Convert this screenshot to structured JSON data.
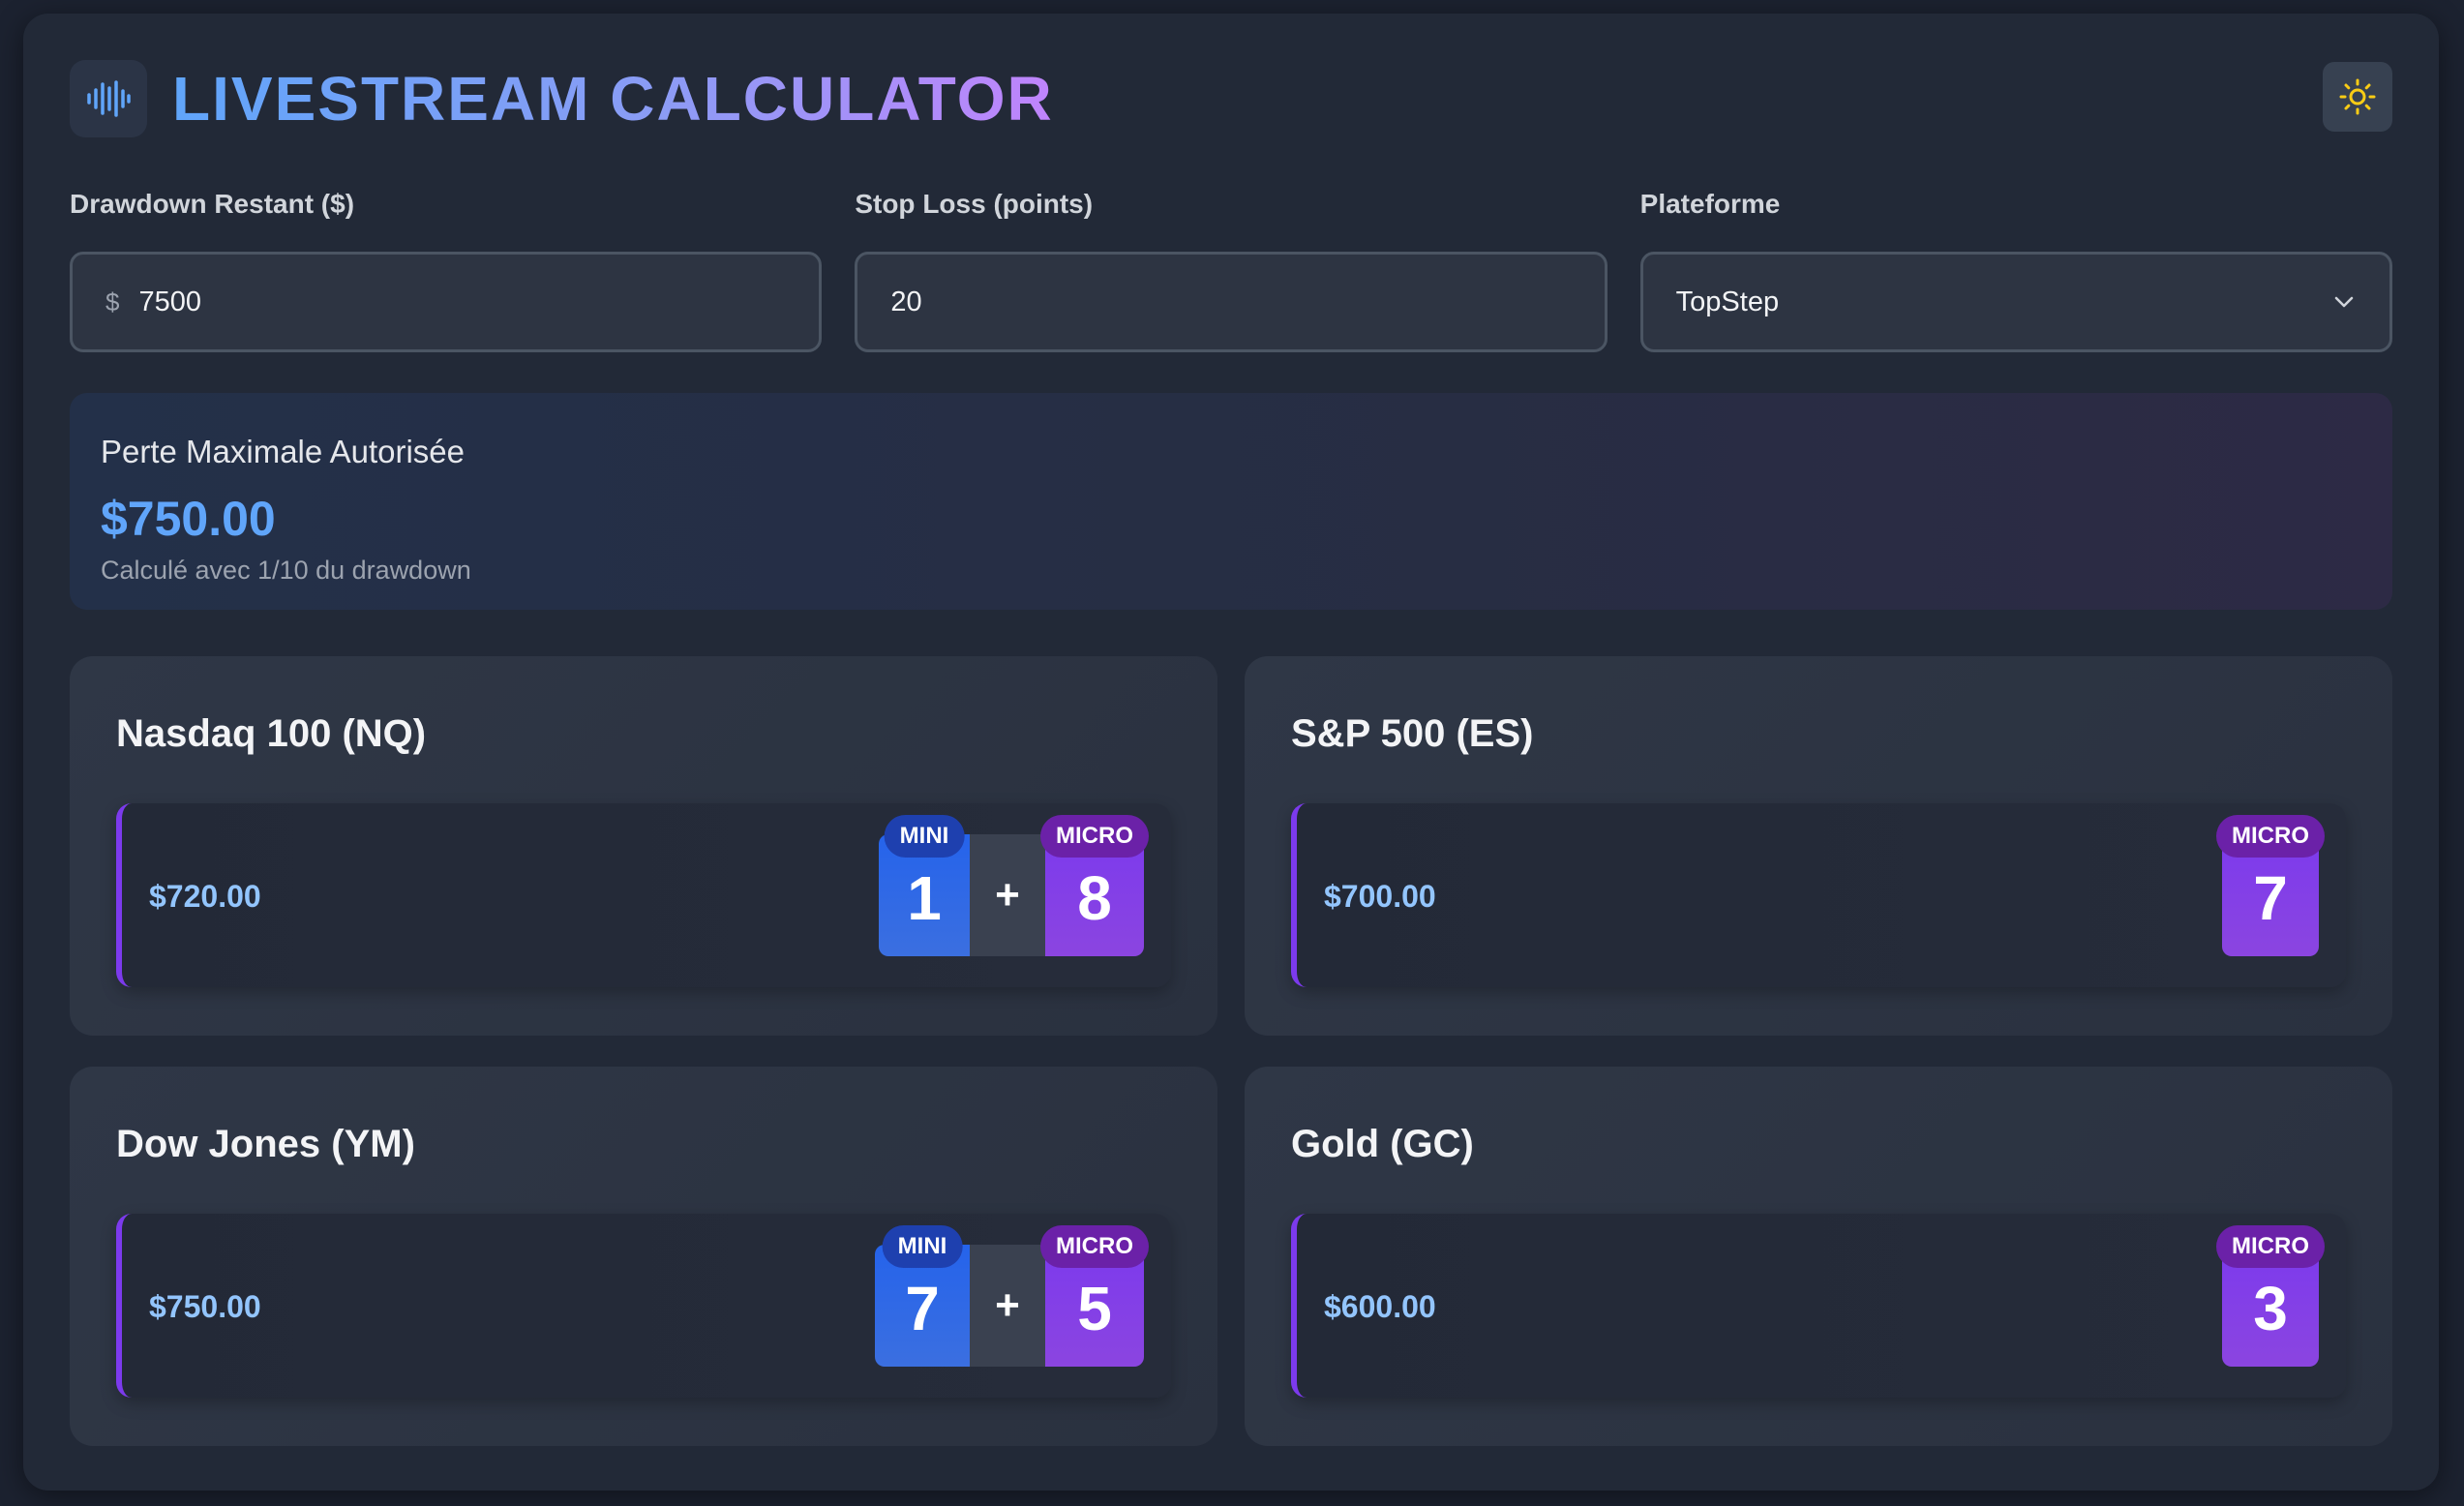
{
  "header": {
    "title": "LIVESTREAM CALCULATOR",
    "logo_icon": "audio-waveform-icon",
    "theme_icon": "sun-icon"
  },
  "fields": {
    "drawdown": {
      "label": "Drawdown Restant ($)",
      "prefix": "$",
      "value": "7500"
    },
    "stoploss": {
      "label": "Stop Loss (points)",
      "value": "20"
    },
    "platform": {
      "label": "Plateforme",
      "value": "TopStep"
    }
  },
  "summary": {
    "label": "Perte Maximale Autorisée",
    "value": "$750.00",
    "note": "Calculé avec 1/10 du drawdown"
  },
  "cards": [
    {
      "title": "Nasdaq 100 (NQ)",
      "amount": "$720.00",
      "mini_label": "MINI",
      "mini": "1",
      "plus": "+",
      "micro_label": "MICRO",
      "micro": "8"
    },
    {
      "title": "S&P 500 (ES)",
      "amount": "$700.00",
      "micro_label": "MICRO",
      "micro": "7"
    },
    {
      "title": "Dow Jones (YM)",
      "amount": "$750.00",
      "mini_label": "MINI",
      "mini": "7",
      "plus": "+",
      "micro_label": "MICRO",
      "micro": "5"
    },
    {
      "title": "Gold (GC)",
      "amount": "$600.00",
      "micro_label": "MICRO",
      "micro": "3"
    }
  ],
  "colors": {
    "accent_blue": "#60a5fa",
    "accent_purple": "#7c3aed",
    "mini_badge": "#2563eb",
    "sun": "#facc15"
  }
}
